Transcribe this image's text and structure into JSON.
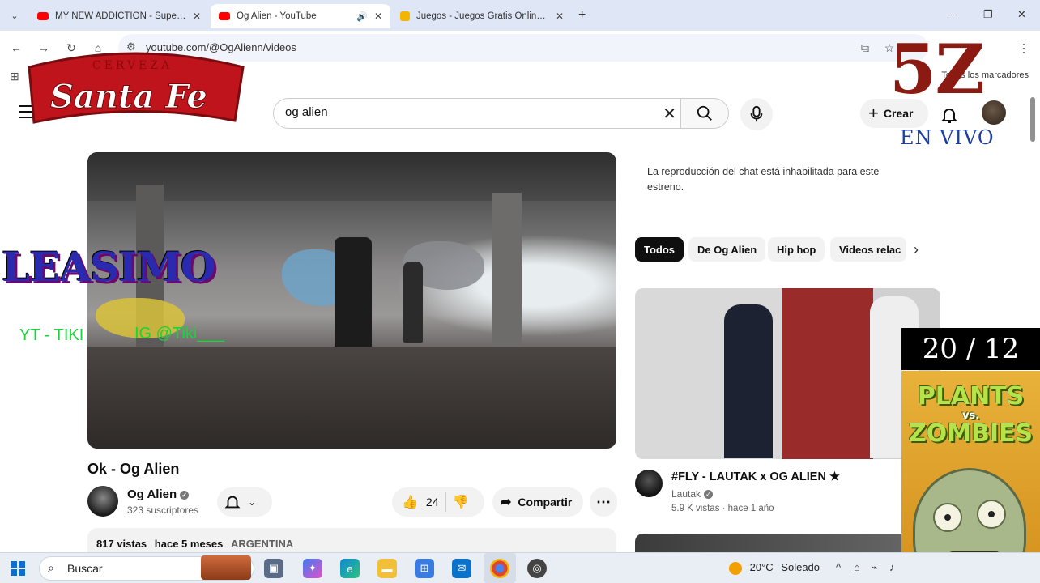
{
  "browser": {
    "tabs": [
      {
        "title": "MY NEW ADDICTION - Superm",
        "favicon_color": "#ff0000",
        "active": false
      },
      {
        "title": "Og Alien - YouTube",
        "favicon_color": "#ff0000",
        "active": true
      },
      {
        "title": "Juegos - Juegos Gratis Online e",
        "favicon_color": "#f5b400",
        "active": false
      }
    ],
    "url": "youtube.com/@OgAlienn/videos",
    "bookmarks_label": "Todos los marcadores"
  },
  "youtube": {
    "search_value": "og alien",
    "create_label": "Crear"
  },
  "video": {
    "title": "Ok - Og Alien",
    "channel": "Og Alien",
    "subscribers": "323 suscriptores",
    "likes": "24",
    "share_label": "Compartir",
    "views": "817 vistas",
    "age": "hace 5 meses",
    "country": "ARGENTINA"
  },
  "sidebar": {
    "chat_note": "La reproducción del chat está inhabilitada para este estreno.",
    "chips": [
      "Todos",
      "De Og Alien",
      "Hip hop",
      "Videos relac"
    ],
    "recommended": {
      "title": "#FLY -  LAUTAK x OG ALIEN ★",
      "channel": "Lautak",
      "meta": "5.9 K vistas · hace 1 año"
    }
  },
  "overlays": {
    "brand_top": "CERVEZA",
    "brand": "Santa Fe",
    "logo_5z": "5Z",
    "live": "EN VIVO",
    "streamer": "LEASIMO",
    "yt_handle": "YT - TIKI",
    "ig_handle": "IG @Tiki___",
    "date": "20 / 12",
    "game_line1": "PLANTS",
    "game_vs": "vs.",
    "game_line2": "ZOMBIES"
  },
  "taskbar": {
    "search_label": "Buscar",
    "weather_temp": "20°C",
    "weather_text": "Soleado"
  },
  "colors": {
    "accent_red": "#ff0000",
    "logo_5z": "#8b1a12",
    "live_blue": "#1f3fa0",
    "overlay_green": "#19d43a"
  }
}
